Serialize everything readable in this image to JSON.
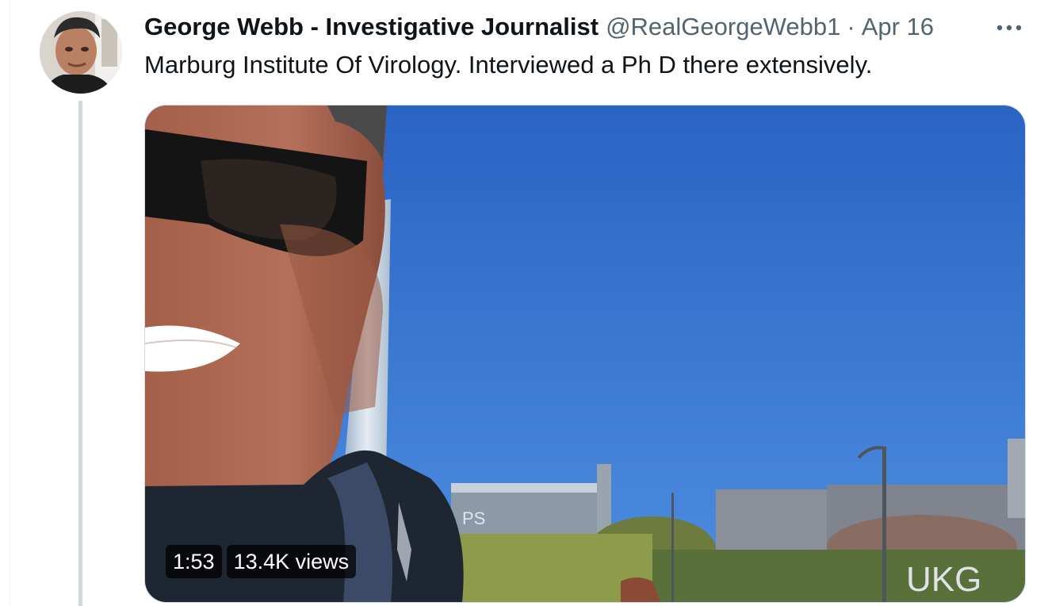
{
  "tweet": {
    "display_name": "George Webb - Investigative Journalist",
    "handle": "@RealGeorgeWebb1",
    "separator": "·",
    "date": "Apr 16",
    "text": "Marburg Institute Of Virology. Interviewed a Ph D there extensively."
  },
  "icons": {
    "more": "more-horizontal-icon",
    "avatar": "profile-photo"
  },
  "media": {
    "type": "video",
    "duration": "1:53",
    "views": "13.4K views",
    "visible_signage": [
      "PS",
      "UKG"
    ]
  },
  "colors": {
    "name_text": "#0f1419",
    "secondary_text": "#536471",
    "thread_line": "#cfd9de",
    "sky": "#2f6fcc"
  }
}
